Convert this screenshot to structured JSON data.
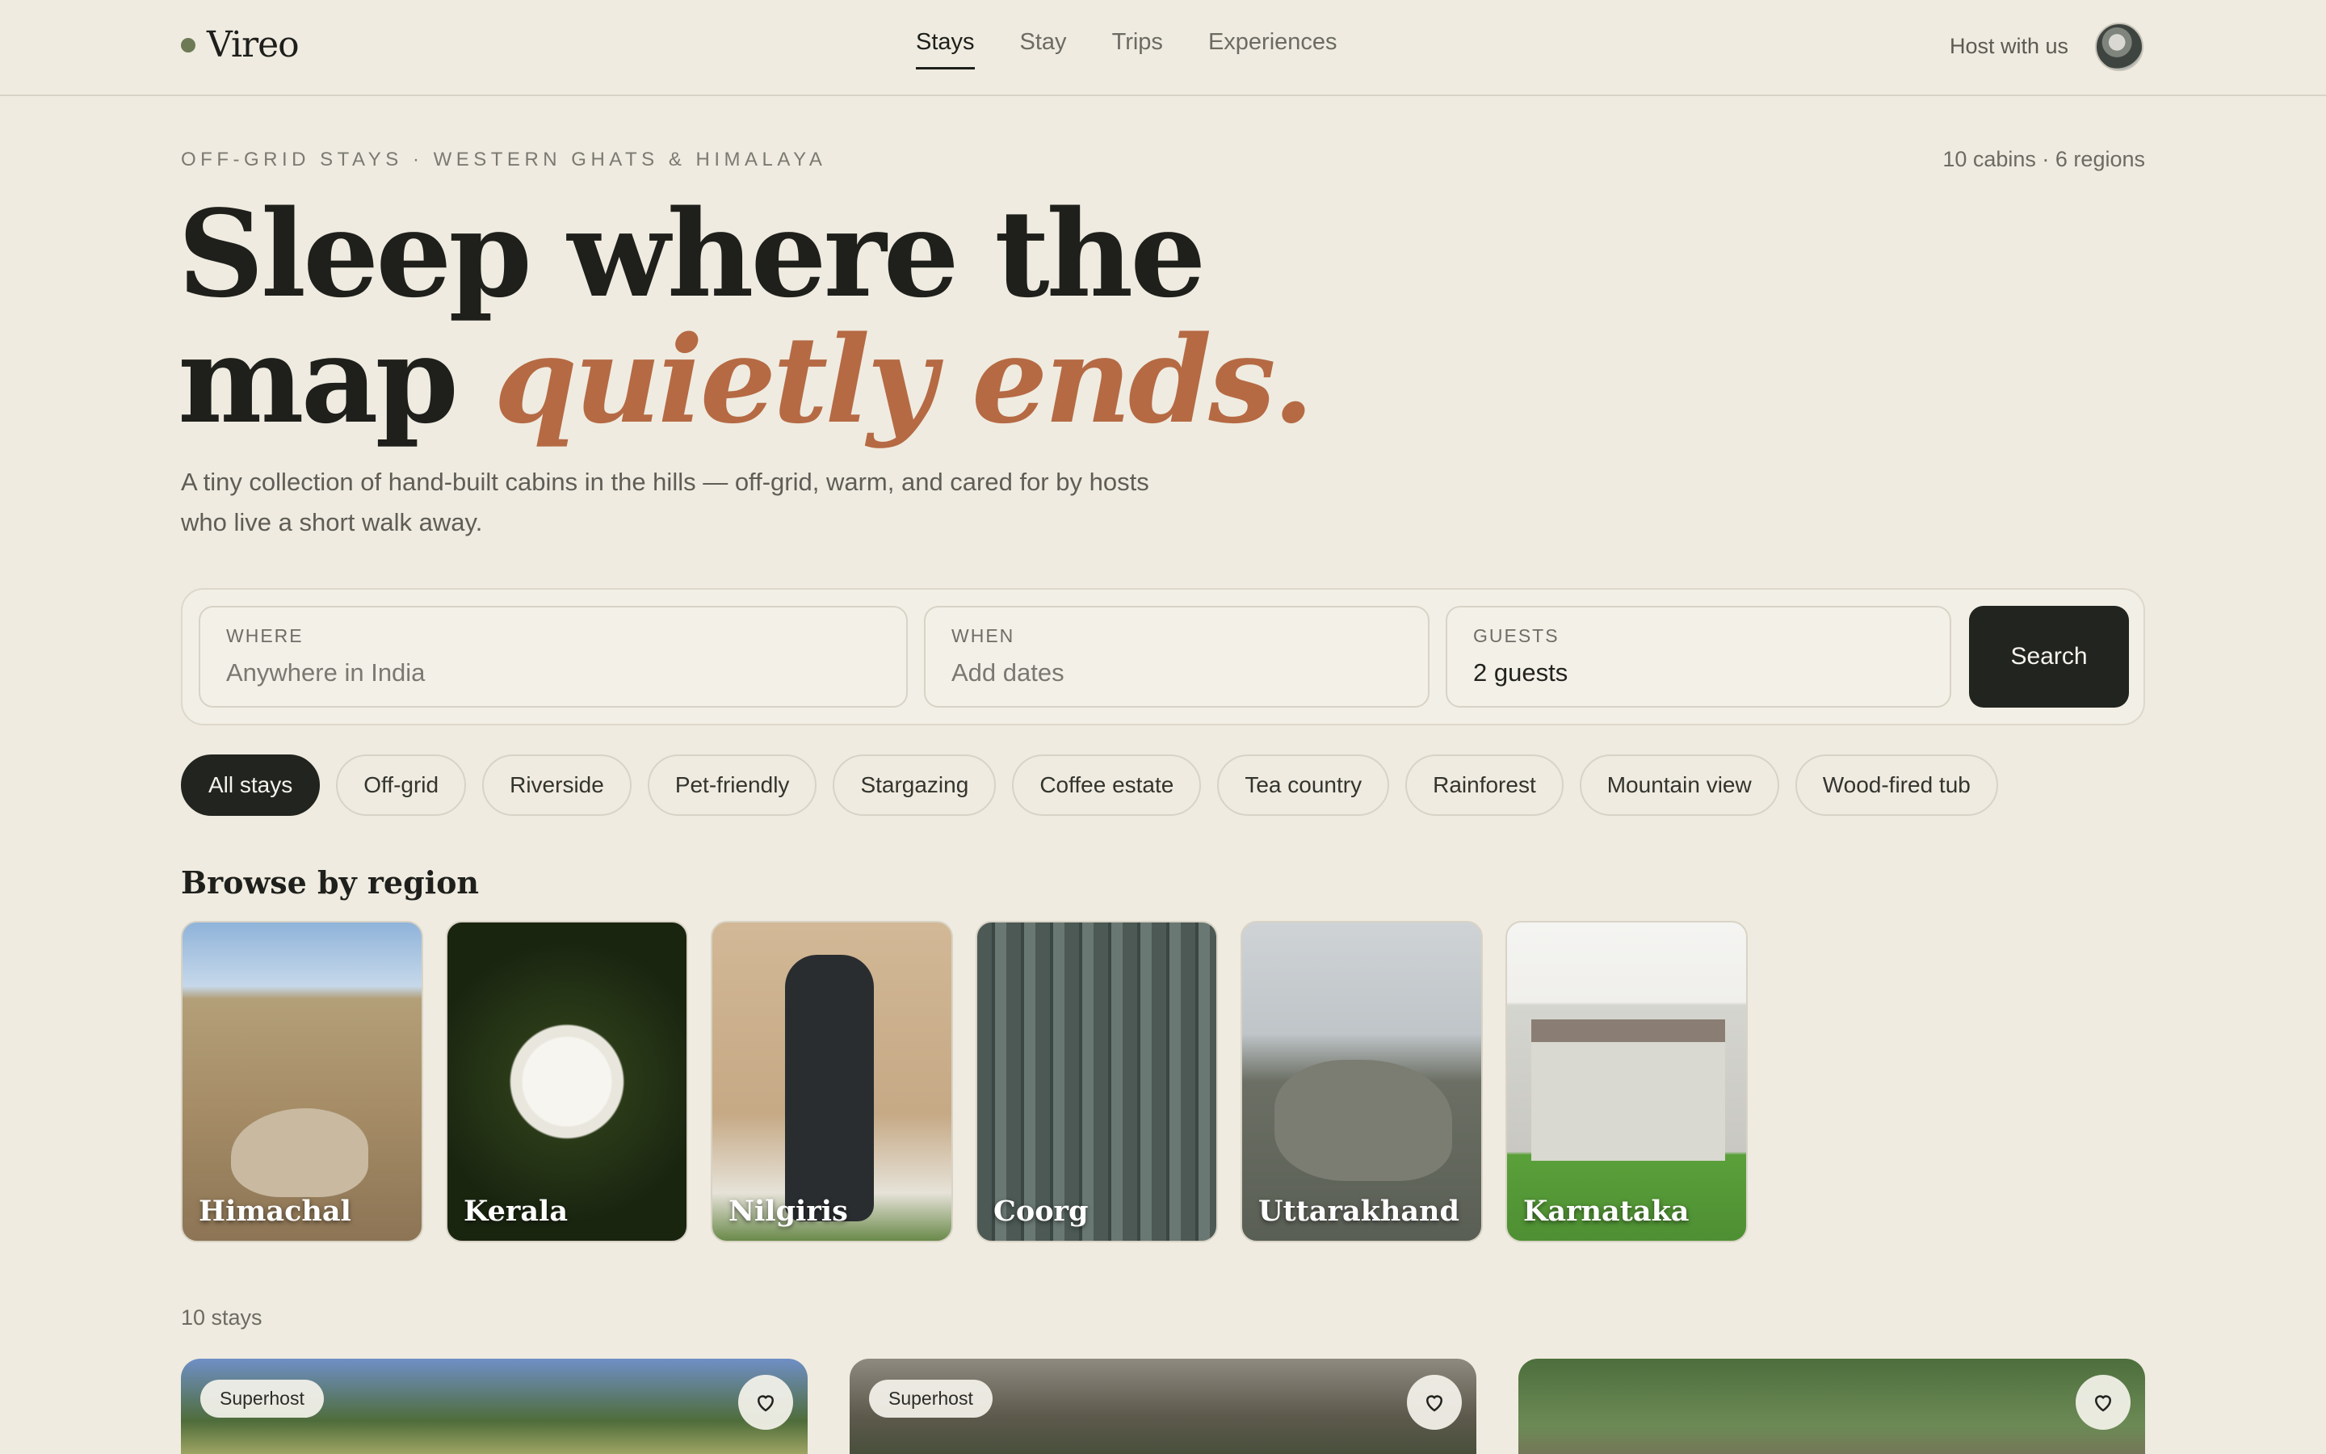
{
  "brand": {
    "name": "Vireo"
  },
  "nav": {
    "items": [
      "Stays",
      "Stay",
      "Trips",
      "Experiences"
    ],
    "active": "Stays"
  },
  "header": {
    "host_label": "Host with us"
  },
  "hero": {
    "eyebrow": "OFF-GRID STAYS · WESTERN GHATS & HIMALAYA",
    "count_info": "10 cabins · 6 regions",
    "headline_line1": "Sleep where the",
    "headline_line2_plain": "map",
    "headline_line2_italic": "quietly ends.",
    "lede": "A tiny collection of hand-built cabins in the hills — off-grid, warm, and cared for by hosts who live a short walk away."
  },
  "search": {
    "where_label": "WHERE",
    "where_placeholder": "Anywhere in India",
    "when_label": "WHEN",
    "when_placeholder": "Add dates",
    "guests_label": "GUESTS",
    "guests_value": "2 guests",
    "button_label": "Search"
  },
  "filters": [
    "All stays",
    "Off-grid",
    "Riverside",
    "Pet-friendly",
    "Stargazing",
    "Coffee estate",
    "Tea country",
    "Rainforest",
    "Mountain view",
    "Wood-fired tub"
  ],
  "regions": {
    "title": "Browse by region",
    "items": [
      "Himachal",
      "Kerala",
      "Nilgiris",
      "Coorg",
      "Uttarakhand",
      "Karnataka"
    ]
  },
  "stays": {
    "count_label": "10 stays",
    "cards": [
      {
        "badge": "Superhost"
      },
      {
        "badge": "Superhost"
      },
      {
        "badge": ""
      }
    ]
  },
  "colors": {
    "accent": "#b56a44",
    "brand_dot": "#6e7a55",
    "dark": "#22241f",
    "background": "#efebe0"
  }
}
